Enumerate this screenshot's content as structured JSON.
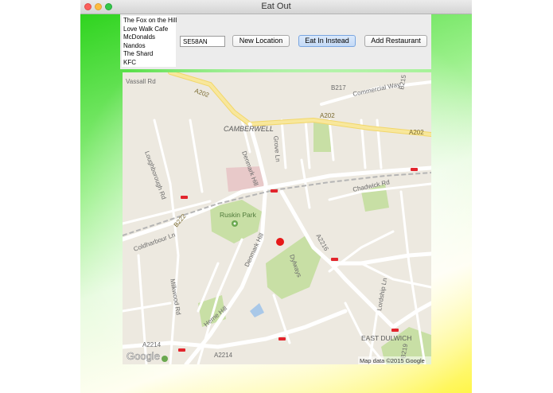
{
  "window": {
    "title": "Eat Out"
  },
  "restaurants": [
    "The Fox on the Hill",
    "Love Walk Cafe",
    "McDonalds",
    "Nandos",
    "The Shard",
    "KFC"
  ],
  "postcode": {
    "value": "SE58AN"
  },
  "buttons": {
    "new_location": "New Location",
    "eat_in": "Eat In Instead",
    "add_restaurant": "Add Restaurant"
  },
  "map": {
    "attribution": "Map data ©2015 Google",
    "google_logo": "Google",
    "labels": {
      "vassall_rd": "Vassall Rd",
      "a202_a": "A202",
      "a202_b": "A202",
      "a202_c": "A202",
      "commercial_way": "Commercial Way",
      "b217": "B217",
      "b215": "B215",
      "camberwell": "CAMBERWELL",
      "ruskin_park": "Ruskin Park",
      "denmark_hill": "Denmark Hill",
      "chadwick_rd": "Chadwick Rd",
      "coldharbour_ln": "Coldharbour Ln",
      "b222": "B222",
      "loughborough_rd": "Loughborough Rd",
      "herne_hill": "Herne Hill",
      "a2214_a": "A2214",
      "a2214_b": "A2214",
      "a2216": "A2216",
      "east_dulwich": "EAST DULWICH",
      "b219": "B219",
      "milkwood_rd": "Milkwood Rd",
      "denmark_hill_2": "Denmark Hill",
      "grove_ln": "Grove Ln",
      "dylways": "Dylways",
      "lordship_ln": "Lordship Ln"
    }
  },
  "colors": {
    "marker": "#e61919",
    "major_road": "#f6e28a",
    "park": "#c8dfa5"
  }
}
